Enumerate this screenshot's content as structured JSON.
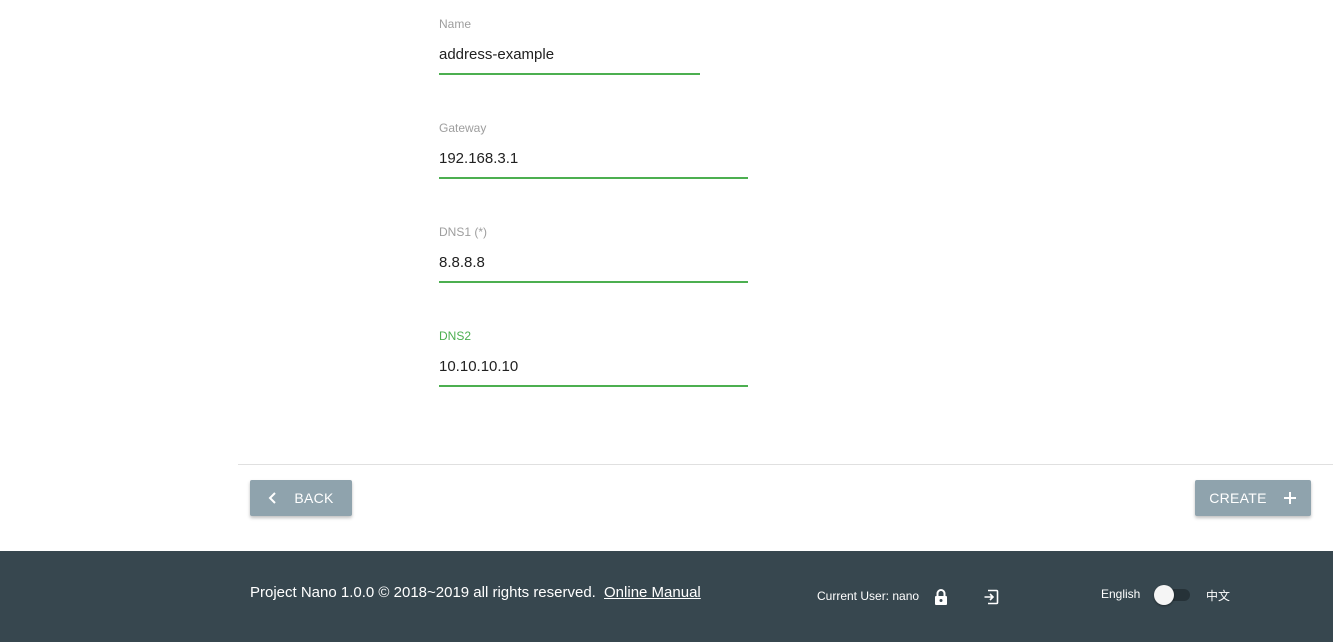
{
  "form": {
    "name": {
      "label": "Name",
      "value": "address-example"
    },
    "gateway": {
      "label": "Gateway",
      "value": "192.168.3.1"
    },
    "dns1": {
      "label": "DNS1 (*)",
      "value": "8.8.8.8"
    },
    "dns2": {
      "label": "DNS2",
      "value": "10.10.10.10"
    }
  },
  "actions": {
    "back_label": "BACK",
    "create_label": "CREATE"
  },
  "footer": {
    "copyright": "Project Nano 1.0.0 © 2018~2019 all rights reserved.",
    "manual_link": "Online Manual",
    "current_user": "Current User: nano",
    "lang_en": "English",
    "lang_zh": "中文"
  },
  "icons": {
    "back": "chevron-left-icon",
    "create": "plus-icon",
    "lock": "lock-icon",
    "logout": "logout-icon"
  },
  "colors": {
    "accent": "#4caf50",
    "button": "#8fa3ad",
    "footer": "#37474f"
  }
}
